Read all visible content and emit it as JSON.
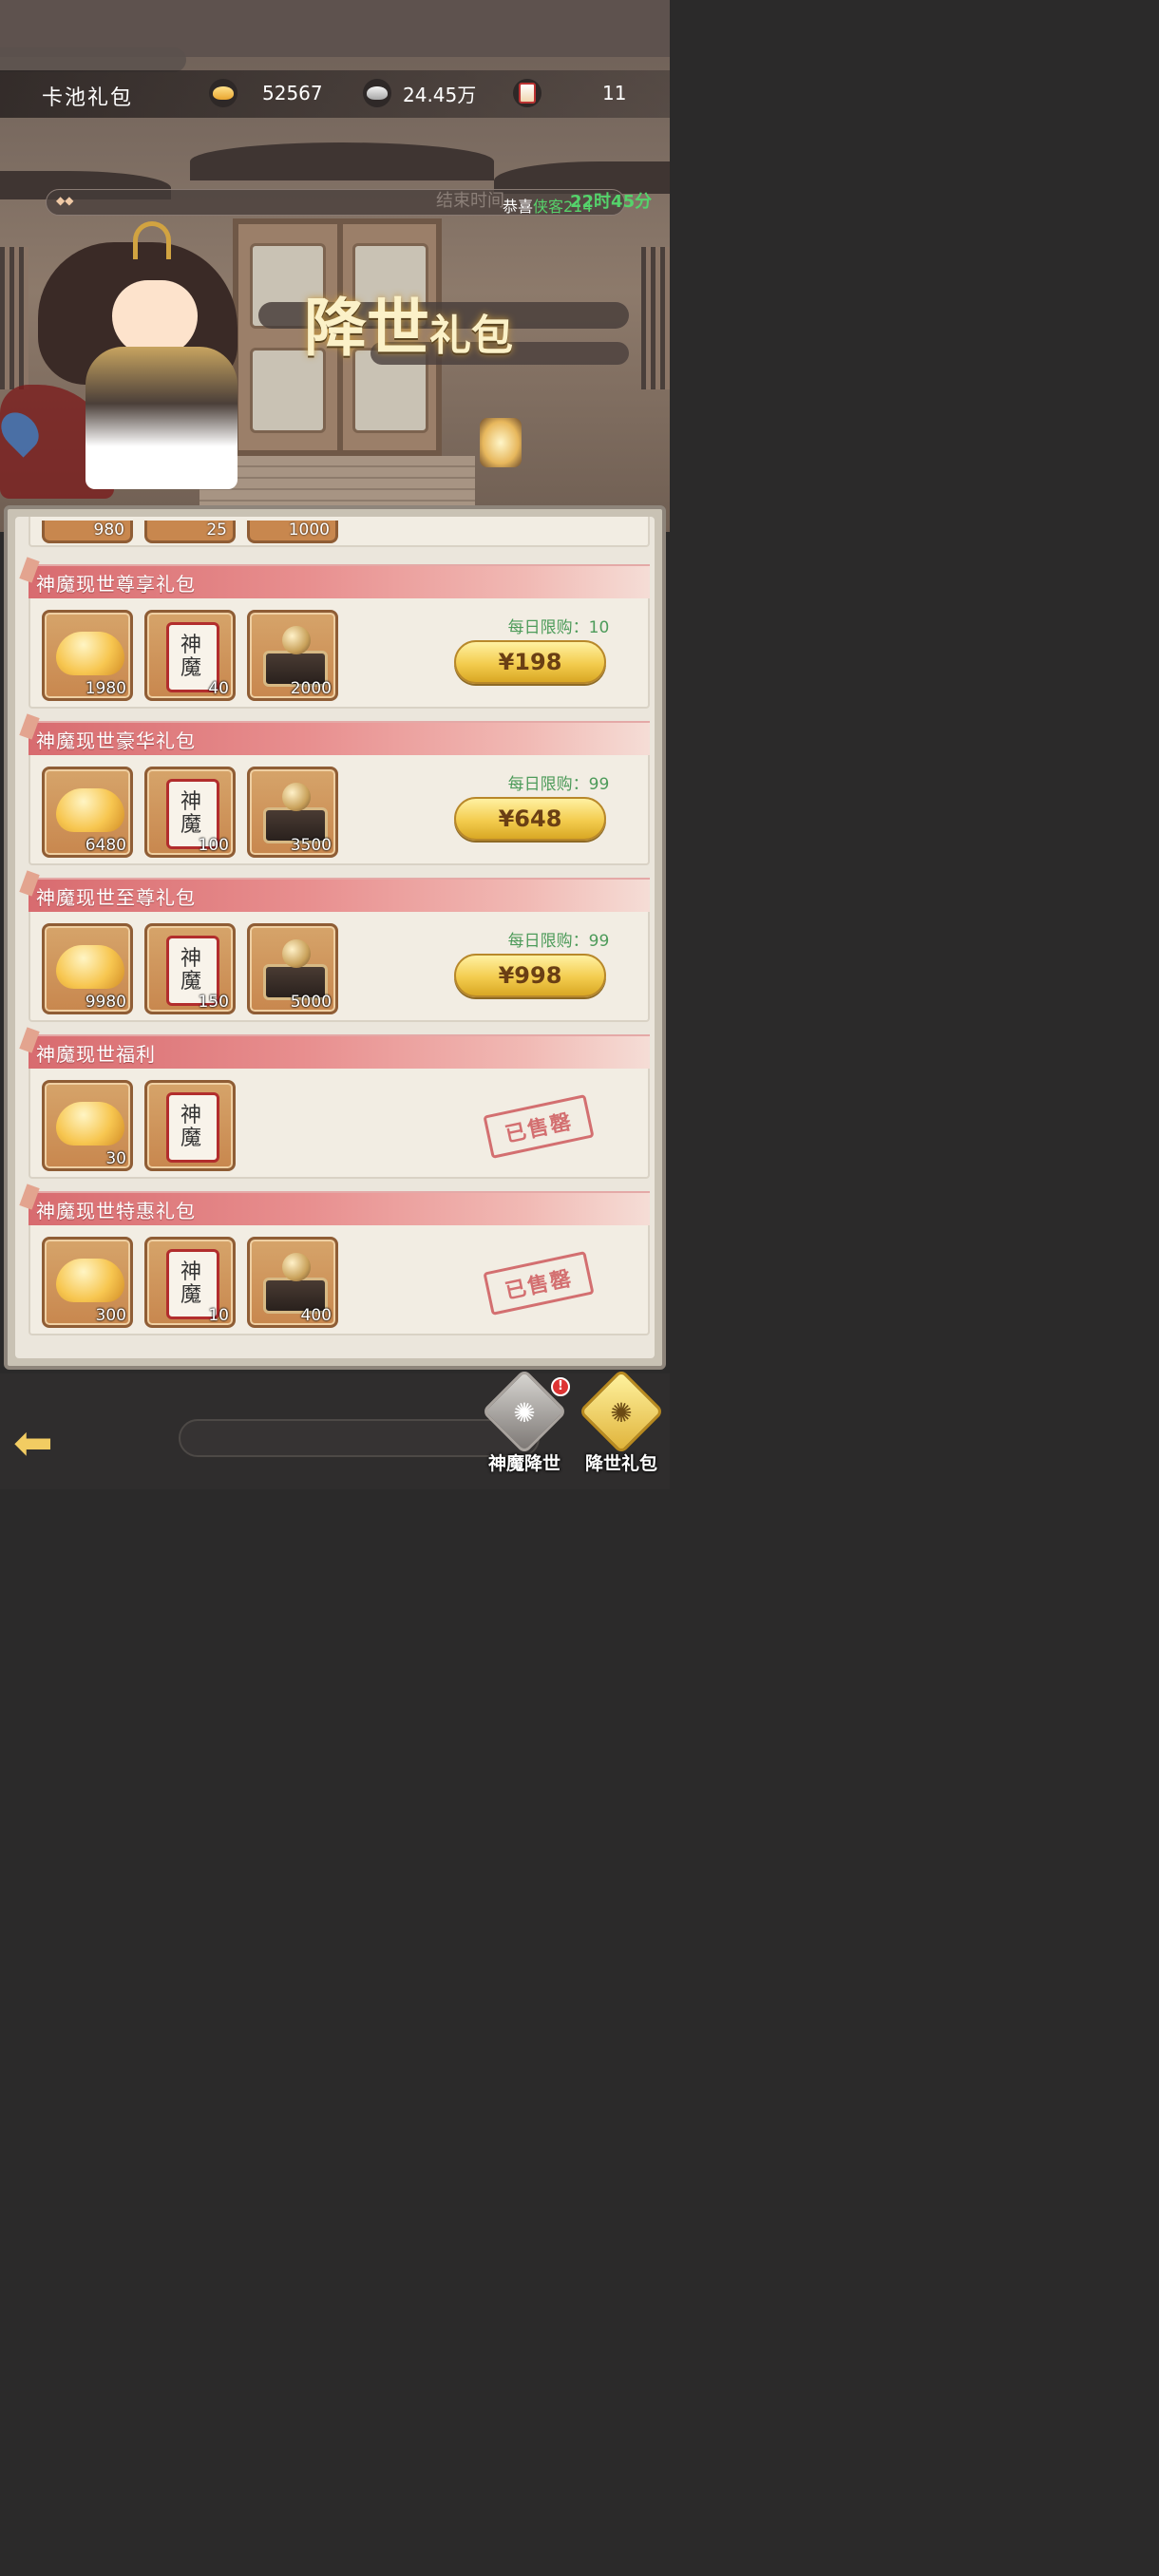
{
  "header": {
    "title": "卡池礼包",
    "resources": [
      {
        "icon": "gold-ingot-icon",
        "value": "52567"
      },
      {
        "icon": "silver-ingot-icon",
        "value": "24.45万"
      },
      {
        "icon": "summon-card-icon",
        "value": "11"
      }
    ]
  },
  "marquee": {
    "dots": "◆◆",
    "end_time_prefix": "结束时间",
    "message_prefix": "恭喜",
    "player_name": "侠客214",
    "countdown": "22时45分"
  },
  "banner": {
    "title_big": "降世",
    "title_small": "礼包"
  },
  "top_partial_item_counts": [
    "980",
    "25",
    "1000"
  ],
  "packages": [
    {
      "name": "神魔现世尊享礼包",
      "items": [
        {
          "icon": "gold-ingot-icon",
          "qty": "1980"
        },
        {
          "icon": "shenmo-scroll-icon",
          "qty": "40"
        },
        {
          "icon": "orb-pedestal-icon",
          "qty": "2000"
        }
      ],
      "limit": "每日限购：10",
      "price": "¥198",
      "status": "available"
    },
    {
      "name": "神魔现世豪华礼包",
      "items": [
        {
          "icon": "gold-ingot-icon",
          "qty": "6480"
        },
        {
          "icon": "shenmo-scroll-icon",
          "qty": "100"
        },
        {
          "icon": "orb-pedestal-icon",
          "qty": "3500"
        }
      ],
      "limit": "每日限购：99",
      "price": "¥648",
      "status": "available"
    },
    {
      "name": "神魔现世至尊礼包",
      "items": [
        {
          "icon": "gold-ingot-icon",
          "qty": "9980"
        },
        {
          "icon": "shenmo-scroll-icon",
          "qty": "150"
        },
        {
          "icon": "orb-pedestal-icon",
          "qty": "5000"
        }
      ],
      "limit": "每日限购：99",
      "price": "¥998",
      "status": "available"
    },
    {
      "name": "神魔现世福利",
      "items": [
        {
          "icon": "gold-ingot-icon",
          "qty": "30"
        },
        {
          "icon": "shenmo-scroll-icon",
          "qty": ""
        }
      ],
      "sold_out_label": "已售罄",
      "status": "sold-out"
    },
    {
      "name": "神魔现世特惠礼包",
      "items": [
        {
          "icon": "gold-ingot-icon",
          "qty": "300"
        },
        {
          "icon": "shenmo-scroll-icon",
          "qty": "10"
        },
        {
          "icon": "orb-pedestal-icon",
          "qty": "400"
        }
      ],
      "sold_out_label": "已售罄",
      "status": "sold-out"
    }
  ],
  "scroll_glyphs": "神魔",
  "bottom_nav": {
    "back": "back-arrow-icon",
    "tabs": [
      {
        "label": "神魔降世",
        "active": false,
        "badge": "!"
      },
      {
        "label": "降世礼包",
        "active": true
      }
    ]
  },
  "colors": {
    "ribbon": "#d86b6f",
    "limit_text": "#4d9b5a",
    "price_button": "#f3cc4e",
    "sold_out_stamp": "#c9464a",
    "countdown": "#54d36b"
  }
}
